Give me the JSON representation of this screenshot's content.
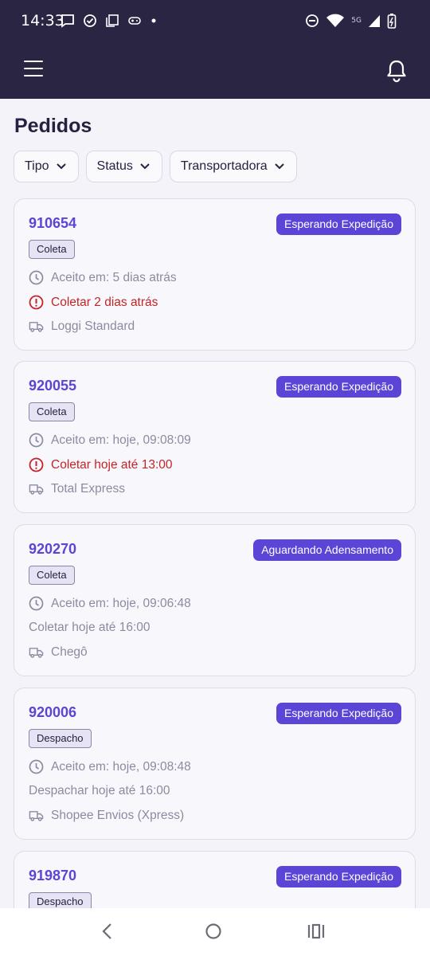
{
  "status_bar": {
    "time": "14:33",
    "network": "5G"
  },
  "page": {
    "title": "Pedidos"
  },
  "filters": [
    {
      "label": "Tipo"
    },
    {
      "label": "Status"
    },
    {
      "label": "Transportadora"
    }
  ],
  "orders": [
    {
      "id": "910654",
      "status": "Esperando Expedição",
      "type": "Coleta",
      "accepted": "Aceito em: 5 dias atrás",
      "deadline": "Coletar 2 dias atrás",
      "deadline_alert": true,
      "carrier": "Loggi Standard"
    },
    {
      "id": "920055",
      "status": "Esperando Expedição",
      "type": "Coleta",
      "accepted": "Aceito em: hoje, 09:08:09",
      "deadline": "Coletar hoje até 13:00",
      "deadline_alert": true,
      "carrier": "Total Express"
    },
    {
      "id": "920270",
      "status": "Aguardando Adensamento",
      "type": "Coleta",
      "accepted": "Aceito em: hoje, 09:06:48",
      "deadline": "Coletar hoje até 16:00",
      "deadline_alert": false,
      "carrier": "Chegô"
    },
    {
      "id": "920006",
      "status": "Esperando Expedição",
      "type": "Despacho",
      "accepted": "Aceito em: hoje, 09:08:48",
      "deadline": "Despachar hoje até 16:00",
      "deadline_alert": false,
      "carrier": "Shopee Envios (Xpress)"
    },
    {
      "id": "919870",
      "status": "Esperando Expedição",
      "type": "Despacho",
      "accepted": "",
      "deadline": "",
      "deadline_alert": false,
      "carrier": ""
    }
  ],
  "colors": {
    "header": "#2b2544",
    "accent": "#5b45d6",
    "alert": "#c42327",
    "muted": "#8c8aa0"
  },
  "icons": [
    "menu-icon",
    "bell-icon",
    "chevron-down-icon",
    "clock-icon",
    "alert-circle-icon",
    "truck-icon",
    "back-icon",
    "home-icon",
    "recents-icon"
  ]
}
